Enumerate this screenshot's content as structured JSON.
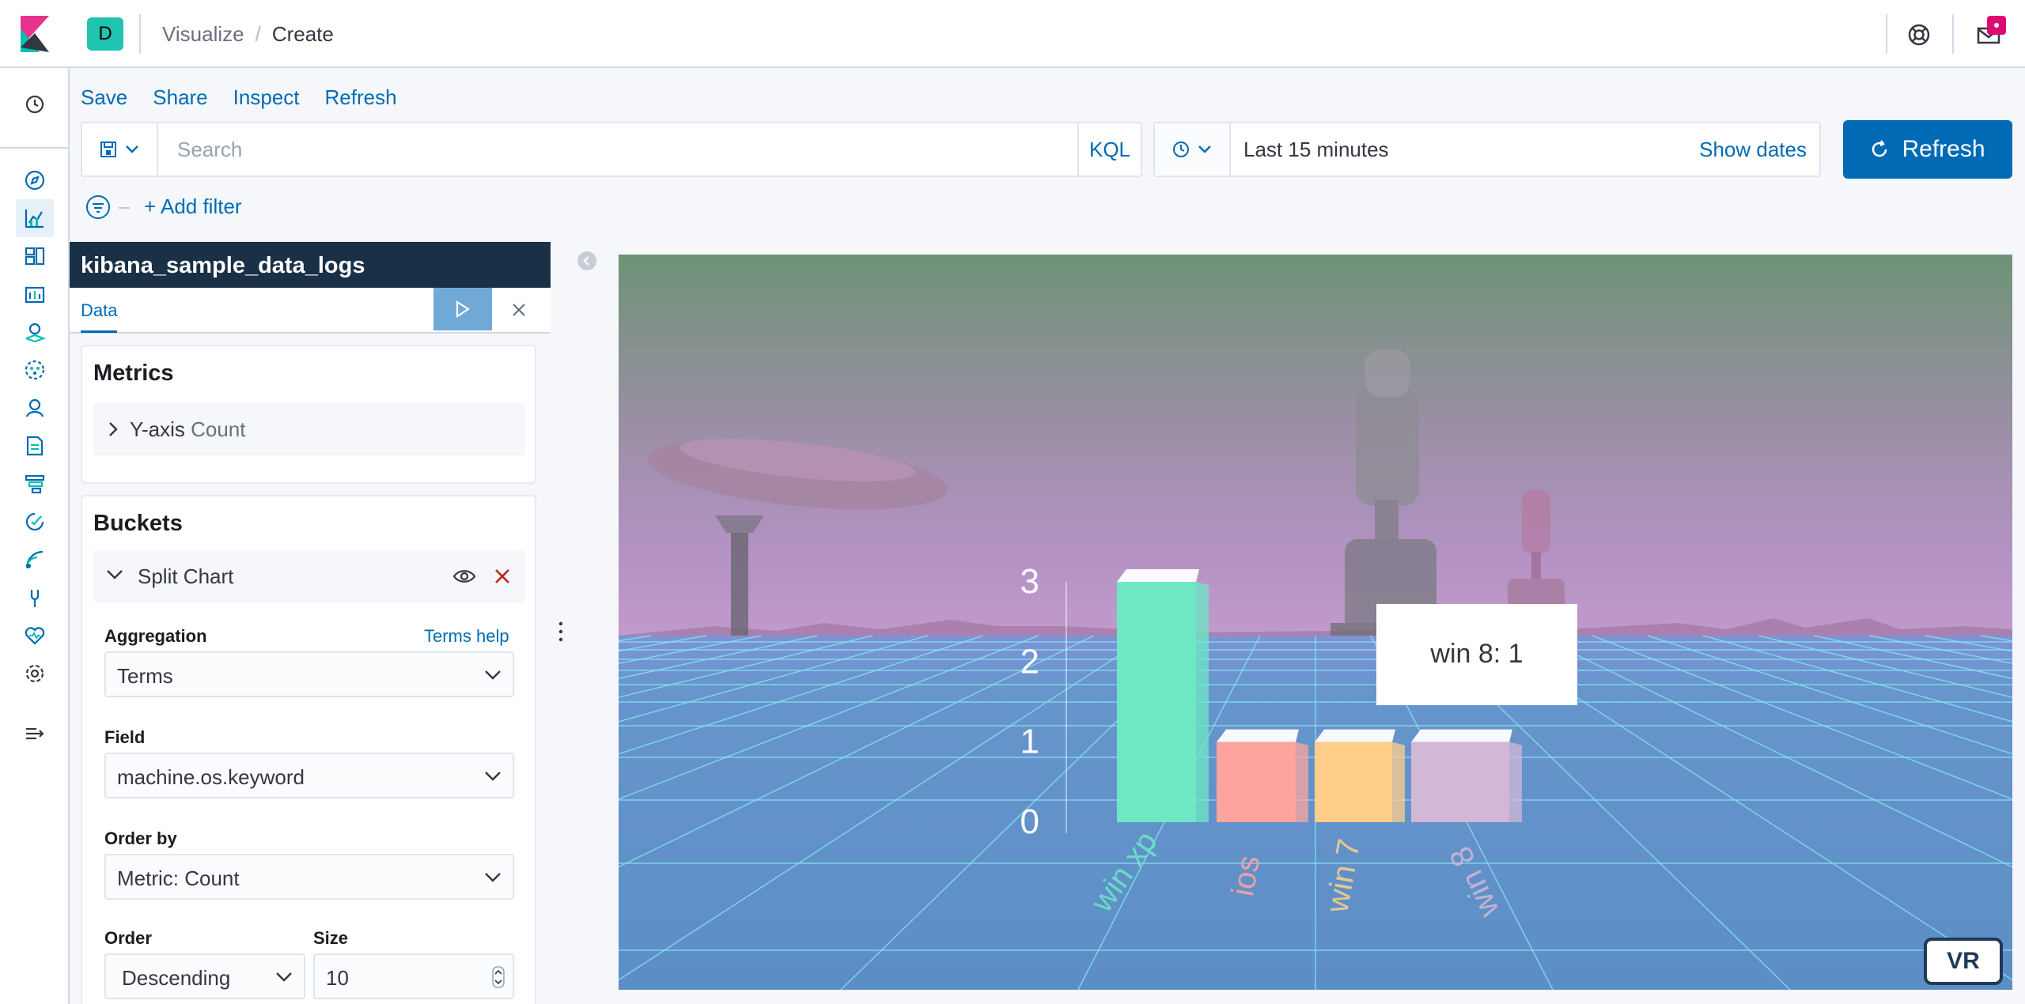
{
  "header": {
    "space_initial": "D",
    "breadcrumbs": [
      "Visualize",
      "Create"
    ],
    "breadcrumb_separator": "/",
    "icons": [
      "kibana-logo-icon",
      "help-icon",
      "mail-icon"
    ]
  },
  "left_nav": {
    "items": [
      "recent-icon",
      "discover-icon",
      "visualize-icon",
      "dashboard-icon",
      "canvas-icon",
      "maps-icon",
      "ml-icon",
      "infrastructure-icon",
      "logs-icon",
      "apm-icon",
      "uptime-icon",
      "siem-icon",
      "dev-tools-icon",
      "monitoring-icon",
      "management-icon",
      "collapse-icon"
    ],
    "active": "visualize-icon"
  },
  "top_menu": {
    "items": [
      "Save",
      "Share",
      "Inspect",
      "Refresh"
    ]
  },
  "query_bar": {
    "search_placeholder": "Search",
    "language": "KQL"
  },
  "time_picker": {
    "value": "Last 15 minutes",
    "show_dates": "Show dates",
    "refresh_label": "Refresh"
  },
  "filter_bar": {
    "add_filter": "+ Add filter"
  },
  "editor": {
    "index_pattern": "kibana_sample_data_logs",
    "tabs": [
      "Data"
    ],
    "metrics": {
      "title": "Metrics",
      "axis_label": "Y-axis",
      "agg": "Count"
    },
    "buckets": {
      "title": "Buckets",
      "split_label": "Split Chart",
      "aggregation_label": "Aggregation",
      "aggregation_help": "Terms help",
      "aggregation_value": "Terms",
      "field_label": "Field",
      "field_value": "machine.os.keyword",
      "order_by_label": "Order by",
      "order_by_value": "Metric: Count",
      "order_label": "Order",
      "order_value": "Descending",
      "size_label": "Size",
      "size_value": "10"
    }
  },
  "visualization": {
    "tooltip": "win 8: 1",
    "vr_label": "VR",
    "colors": {
      "sky_top": "#6d9376",
      "sky_mid": "#9a8fa4",
      "horizon": "#b392c4",
      "floor": "#5c91c9",
      "grid": "#84e4f3"
    }
  },
  "chart_data": {
    "type": "bar",
    "categories": [
      "win xp",
      "ios",
      "win 7",
      "win 8"
    ],
    "values": [
      3,
      1,
      1,
      1
    ],
    "colors": [
      "#6ee8c4",
      "#ffa49c",
      "#ffcf8a",
      "#d3b7d6"
    ],
    "yticks": [
      "3",
      "2",
      "1",
      "0"
    ],
    "ylim": [
      0,
      3
    ]
  }
}
